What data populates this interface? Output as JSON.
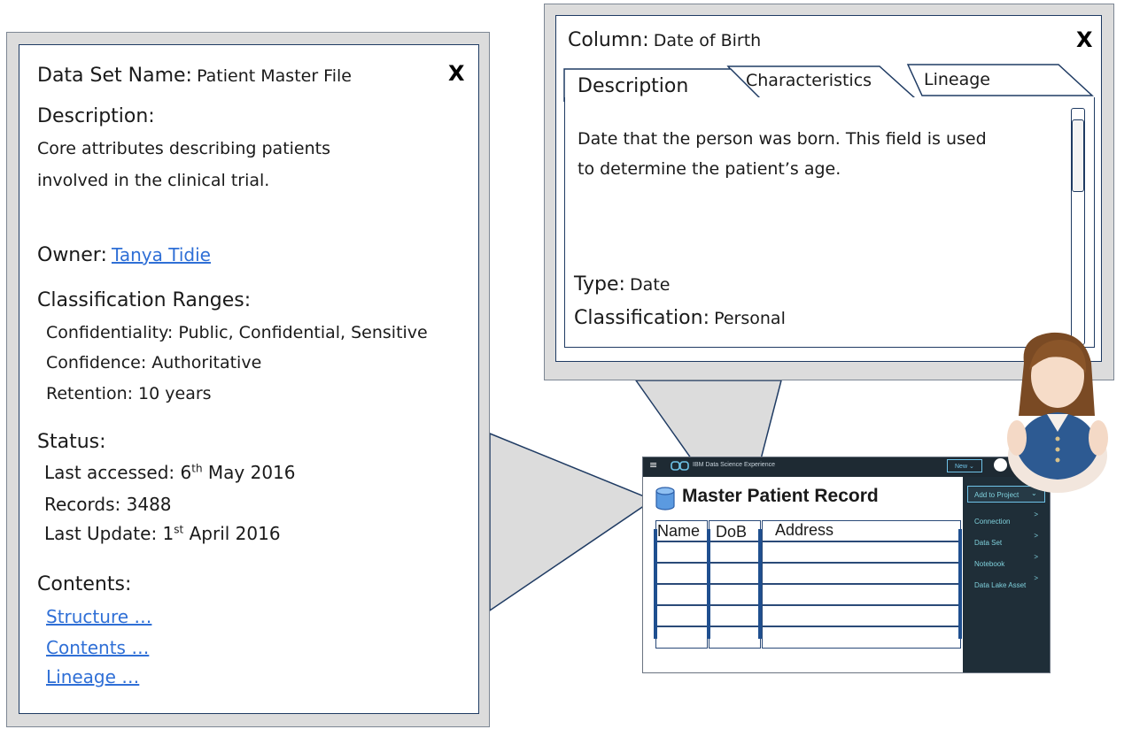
{
  "dataset_panel": {
    "name_label": "Data Set Name:",
    "name_value": "Patient Master File",
    "close": "X",
    "description_label": "Description:",
    "description_line1": "Core attributes describing patients",
    "description_line2": "involved in the clinical trial.",
    "owner_label": "Owner:",
    "owner_value": "Tanya Tidie",
    "classification_label": "Classification Ranges:",
    "confidentiality": "Confidentiality: Public, Confidential, Sensitive",
    "confidence": "Confidence: Authoritative",
    "retention": "Retention: 10 years",
    "status_label": "Status:",
    "last_accessed_prefix": "Last accessed: 6",
    "last_accessed_sup": "th",
    "last_accessed_suffix": " May 2016",
    "records": "Records: 3488",
    "last_update_prefix": "Last Update: 1",
    "last_update_sup": "st",
    "last_update_suffix": " April 2016",
    "contents_label": "Contents:",
    "links": [
      "Structure …",
      "Contents …",
      "Lineage …"
    ]
  },
  "column_panel": {
    "column_label": "Column:",
    "column_value": "Date of Birth",
    "close": "X",
    "tabs": [
      "Description",
      "Characteristics",
      "Lineage"
    ],
    "description_line1": "Date that the person was born.  This field is used",
    "description_line2": "to determine the patient’s age.",
    "type_label": "Type:",
    "type_value": "Date",
    "classification_label": "Classification:",
    "classification_value": "Personal"
  },
  "app": {
    "brand": "IBM Data Science Experience",
    "new_button": "New",
    "title": "Master Patient Record",
    "columns": [
      "Name",
      "DoB",
      "Address"
    ],
    "menu": {
      "add": "Add to Project",
      "items": [
        "Connection",
        "Data Set",
        "Notebook",
        "Data Lake Asset"
      ]
    }
  }
}
